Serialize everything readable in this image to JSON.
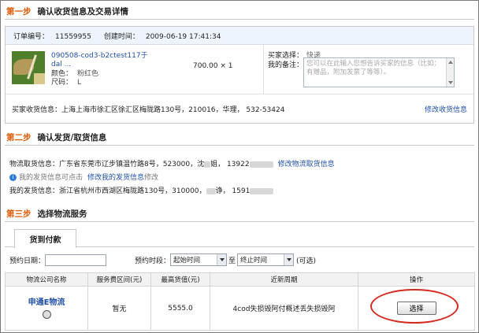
{
  "step1": {
    "num": "第一步",
    "title": "确认收货信息及交易详情",
    "order_no_label": "订单编号：",
    "order_no": "11559955",
    "created_label": "创建时间：",
    "created": "2009-06-19 17:41:34",
    "product": {
      "name_line1": "090508-cod3-b2ctest117于",
      "name_line2": "dal ...",
      "color_label": "颜色：",
      "color": "粉红色",
      "size_label": "尺码：",
      "size": "L",
      "price": "700.00 × 1"
    },
    "buyer_choice_label": "买家选择：",
    "buyer_choice": "快递",
    "remark_label": "我的备注：",
    "remark_placeholder": "您可以在此输入您想告诉买家的信息（比如：有赠品，附加发票了等等）。",
    "buyer_address": "买家收货信息：上海上海市徐汇区徐汇区梅陇路130号，210016，华理， 532-53424",
    "edit_address_link": "修改收货信息"
  },
  "step2": {
    "num": "第二步",
    "title": "确认发货/取货信息",
    "pickup_prefix": "物流取货信息：广东省东莞市辽步镇温竹路8号，523000，沈",
    "pickup_suffix": "姐，  13922",
    "edit_pickup_link": "修改物流取货信息",
    "notice_text": "我的发货信息可点击",
    "edit_ship_link": "修改我的发货信息",
    "notice_tail": "修改",
    "ship_prefix": "我的发货信息：浙江省杭州市西湖区梅陇路130号，310000，",
    "ship_mid": "诤，  1591"
  },
  "step3": {
    "num": "第三步",
    "title": "选择物流服务",
    "tab": "货到付款",
    "date_label": "预约日期：",
    "slot_label": "预约时段：",
    "start_time": "起始时间",
    "to_label": "至",
    "end_time": "终止时间",
    "optional": "(可选)",
    "headers": [
      "物流公司名称",
      "服务费区间(元)",
      "最高货值(元)",
      "近新周期",
      "操作"
    ],
    "row": {
      "company": "申通E物流",
      "fee": "暂无",
      "max_value": "5555.0",
      "cycle": "4cod失损毁阿付概述丢失损毁阿",
      "action": "选择"
    }
  },
  "colors": {
    "step_number": "#e05a00",
    "link": "#1e4fa8",
    "highlight_ring": "#d42a1e"
  }
}
